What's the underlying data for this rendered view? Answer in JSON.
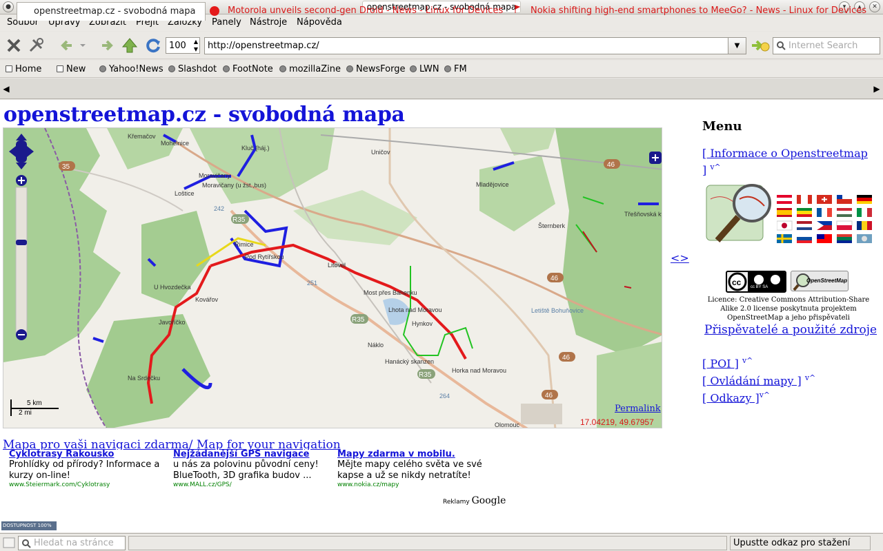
{
  "window": {
    "title": "openstreetmap.cz - svobodná mapa"
  },
  "menubar": [
    "Soubor",
    "Úpravy",
    "Zobrazit",
    "Přejít",
    "Záložky",
    "Panely",
    "Nástroje",
    "Nápověda"
  ],
  "toolbar": {
    "zoom": "100",
    "url": "http://openstreetmap.cz/",
    "search_placeholder": "Internet Search"
  },
  "bookmarks": [
    "Home",
    "New",
    "Yahoo!News",
    "Slashdot",
    "FootNote",
    "mozillaZine",
    "NewsForge",
    "LWN",
    "FM"
  ],
  "tabs": [
    {
      "label": "openstreetmap.cz - svobodná mapa"
    },
    {
      "label": "Motorola unveils second-gen Droid - News - Linux for Devices"
    },
    {
      "label": "Nokia shifting high-end smartphones to MeeGo? - News - Linux for Devices"
    }
  ],
  "page": {
    "title": "openstreetmap.cz - svobodná mapa",
    "map": {
      "permalink": "Permalink",
      "coords": "17.04219, 49.67957",
      "scale_km": "5 km",
      "scale_mi": "2 mi",
      "towns": [
        "Mohelnice",
        "Loštice",
        "Moravičany",
        "Uničov",
        "Mladějovice",
        "Šternberk",
        "Litovel",
        "Most přes Bahenku",
        "Lhota nad Moravou",
        "Hynkov",
        "Náklo",
        "Hanácký skanzen",
        "Horka nad Moravou",
        "Na Srdečku",
        "Kovářov",
        "Javoříčko",
        "U Hvozdečka",
        "Řimice",
        "Pod Rytířskou",
        "Olomouc",
        "Letiště Bohuňovice",
        "Třešňovská kyselka",
        "Moravičany (u žst.,bus)",
        "Kluč (háj.)",
        "Křemačov"
      ],
      "roads": [
        "35",
        "46",
        "R35",
        "242",
        "251",
        "264"
      ]
    },
    "menu": {
      "heading": "Menu",
      "items": [
        {
          "label": "[ Informace o Openstreetmap ]",
          "sup": "v^"
        },
        {
          "label": "[ POI ]",
          "sup": "v^"
        },
        {
          "label": "[ Ovládání mapy ]",
          "sup": "v^"
        },
        {
          "label": "[ Odkazy ]",
          "sup": "v^"
        }
      ],
      "toggle": "<>",
      "licence": "Licence: Creative Commons Attribution-Share Alike 2.0 license poskytnuta projektem OpenStreetMap a jeho přispěvateli",
      "contributors": "Přispěvatelé a použité zdroje",
      "cc_badge": "cc BY SA",
      "osm_badge": "OpenStreetMap"
    },
    "ad_strip": "Mapa pro vaši navigaci zdarma/ Map for your navigation",
    "ads": [
      {
        "title": "Cyklotrasy Rakousko",
        "desc": "Prohlídky od přírody? Informace a kurzy on-line!",
        "url": "www.Steiermark.com/Cyklotrasy"
      },
      {
        "title": "Nejžádanější GPS navigace",
        "desc": "u nás za polovinu původní ceny! BlueTooth, 3D grafika budov ...",
        "url": "www.MALL.cz/GPS/"
      },
      {
        "title": "Mapy zdarma v mobilu.",
        "desc": "Mějte mapy celého světa ve své kapse a už se nikdy netratíte!",
        "url": "www.nokia.cz/mapy"
      }
    ],
    "ads_label": "Reklamy",
    "ads_brand": "Google",
    "badge": "DOSTUPNOST 100%"
  },
  "status": {
    "find_placeholder": "Hledat na stránce",
    "text": "Upustte odkaz pro stažení"
  },
  "colors": {
    "link": "#1414d8",
    "tab_inactive": "#d91818",
    "forest": "#9fc98f",
    "route_red": "#e31a1c",
    "route_blue": "#1f1fe0",
    "route_green": "#22c322"
  }
}
